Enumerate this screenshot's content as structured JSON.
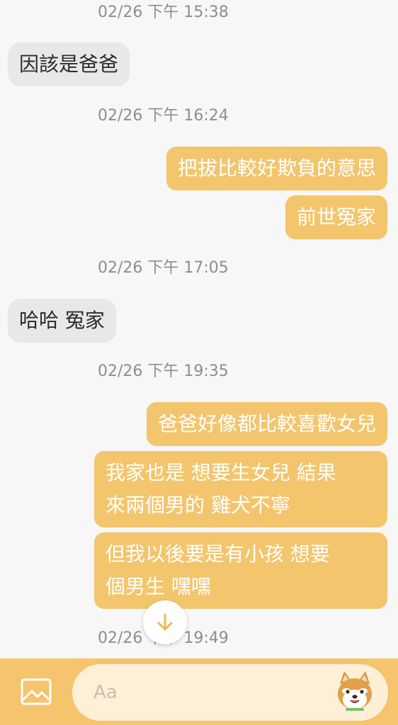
{
  "messages": [
    {
      "type": "timestamp",
      "text": "02/26 下午 15:38"
    },
    {
      "type": "received",
      "text": "因該是爸爸"
    },
    {
      "type": "timestamp",
      "text": "02/26 下午 16:24"
    },
    {
      "type": "sent",
      "text": "把拔比較好欺負的意思"
    },
    {
      "type": "sent",
      "text": "前世冤家"
    },
    {
      "type": "timestamp",
      "text": "02/26 下午 17:05"
    },
    {
      "type": "received",
      "text": "哈哈 冤家"
    },
    {
      "type": "timestamp",
      "text": "02/26 下午 19:35"
    },
    {
      "type": "sent",
      "text": "爸爸好像都比較喜歡女兒"
    },
    {
      "type": "sent",
      "lines": [
        "我家也是 想要生女兒 結果",
        "來兩個男的 雞犬不寧"
      ]
    },
    {
      "type": "sent",
      "lines": [
        "但我以後要是有小孩 想要",
        "個男生 嘿嘿"
      ]
    },
    {
      "type": "timestamp",
      "text": "02/26 下午 19:49"
    }
  ],
  "composer": {
    "placeholder": "Aa",
    "image_icon": "image-icon",
    "sticker_icon": "shiba-sticker-icon",
    "scroll_icon": "arrow-down-icon"
  },
  "colors": {
    "accent": "#f5c46c",
    "sent_bubble": "#f3c56d",
    "received_bubble": "#e8e8e8",
    "timestamp": "#8e8e8e"
  }
}
